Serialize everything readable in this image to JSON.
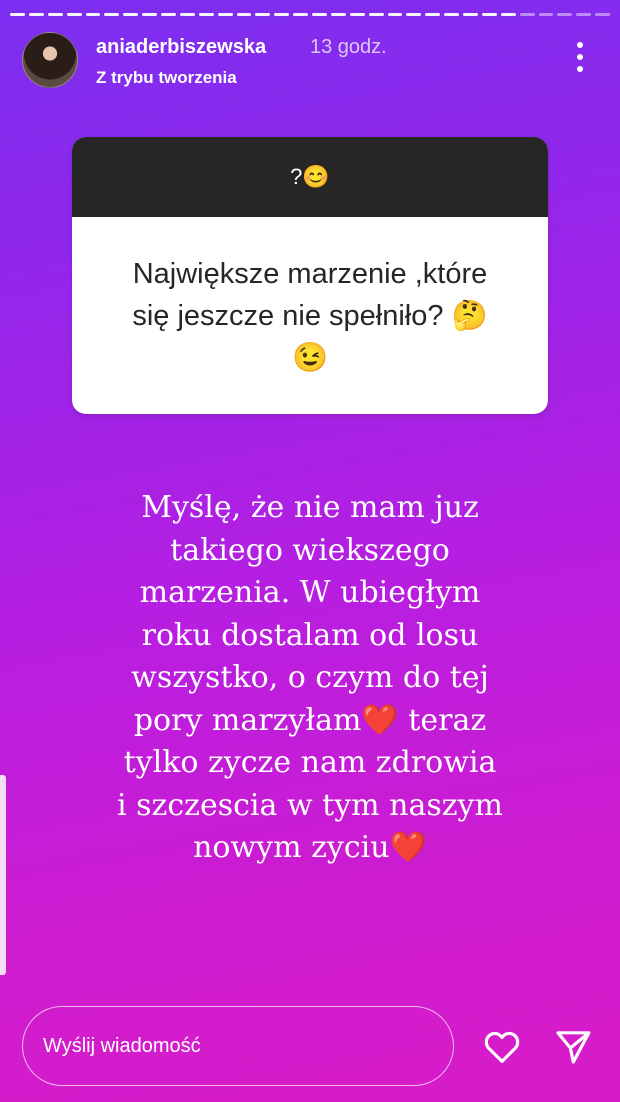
{
  "story": {
    "segments": [
      "done",
      "done",
      "done",
      "done",
      "done",
      "done",
      "done",
      "done",
      "done",
      "done",
      "done",
      "done",
      "done",
      "done",
      "done",
      "done",
      "done",
      "done",
      "done",
      "done",
      "done",
      "done",
      "done",
      "done",
      "done",
      "done",
      "done",
      "todo",
      "todo",
      "todo",
      "todo",
      "todo"
    ]
  },
  "header": {
    "username": "aniaderbiszewska",
    "time": "13 godz.",
    "subtitle": "Z trybu tworzenia"
  },
  "question": {
    "header": "?😊",
    "text": "Największe marzenie ,które\nsię jeszcze nie spełniło?  🤔\n😉"
  },
  "answer": {
    "text": "Myślę, że nie mam juz\ntakiego wiekszego\nmarzenia. W ubiegłym\nroku dostalam od losu\nwszystko, o czym do tej\npory marzyłam❤️ teraz\ntylko zycze nam zdrowia\ni szczescia w tym naszym\nnowym zyciu❤️"
  },
  "footer": {
    "message_placeholder": "Wyślij wiadomość",
    "message_value": ""
  },
  "icons": {
    "menu": "more-vertical-icon",
    "like": "heart-icon",
    "send": "send-icon"
  },
  "colors": {
    "gradient_top": "#7b2ff0",
    "gradient_bottom": "#d81bc8",
    "question_header": "#262626"
  }
}
